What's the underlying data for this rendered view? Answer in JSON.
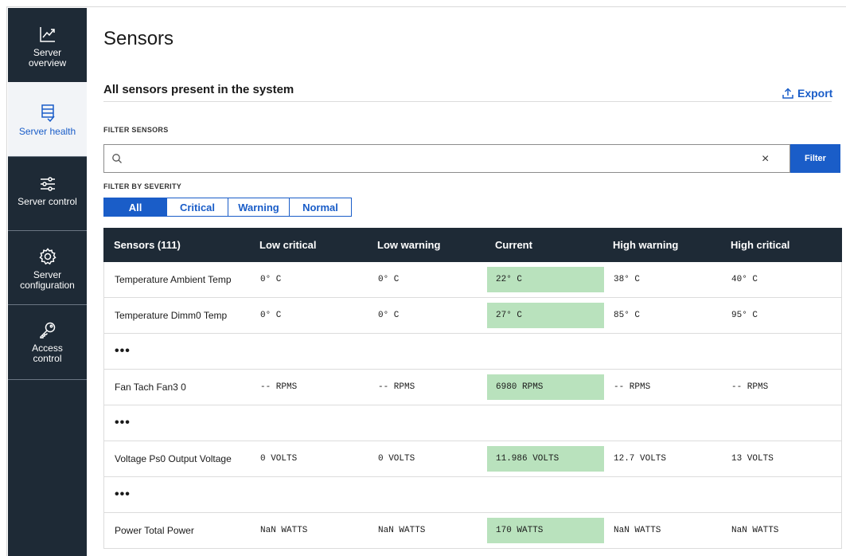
{
  "sidebar": {
    "items": [
      {
        "label": "Server\noverview",
        "icon": "chart-line-icon"
      },
      {
        "label": "Server health",
        "icon": "server-check-icon"
      },
      {
        "label": "Server control",
        "icon": "sliders-icon"
      },
      {
        "label": "Server\nconfiguration",
        "icon": "gear-icon"
      },
      {
        "label": "Access\ncontrol",
        "icon": "key-icon"
      }
    ]
  },
  "page": {
    "title": "Sensors",
    "section_title": "All sensors present in the system",
    "export_label": "Export"
  },
  "filter": {
    "label": "FILTER SENSORS",
    "search_value": "",
    "clear_symbol": "×",
    "button_label": "Filter"
  },
  "severity": {
    "label": "FILTER BY SEVERITY",
    "options": [
      "All",
      "Critical",
      "Warning",
      "Normal"
    ],
    "selected": "All"
  },
  "table": {
    "headers": [
      "Sensors (111)",
      "Low critical",
      "Low warning",
      "Current",
      "High warning",
      "High critical"
    ],
    "rows": [
      {
        "name": "Temperature Ambient Temp",
        "low_critical": "0° C",
        "low_warning": "0° C",
        "current": "22° C",
        "high_warning": "38° C",
        "high_critical": "40° C"
      },
      {
        "name": "Temperature Dimm0 Temp",
        "low_critical": "0° C",
        "low_warning": "0° C",
        "current": "27° C",
        "high_warning": "85° C",
        "high_critical": "95° C"
      },
      {
        "ellipsis": "•••"
      },
      {
        "name": "Fan Tach Fan3 0",
        "low_critical": "-- RPMS",
        "low_warning": "-- RPMS",
        "current": "6980 RPMS",
        "high_warning": "-- RPMS",
        "high_critical": "-- RPMS"
      },
      {
        "ellipsis": "•••"
      },
      {
        "name": "Voltage Ps0 Output Voltage",
        "low_critical": "0 VOLTS",
        "low_warning": "0 VOLTS",
        "current": "11.986 VOLTS",
        "high_warning": "12.7 VOLTS",
        "high_critical": "13 VOLTS"
      },
      {
        "ellipsis": "•••"
      },
      {
        "name": "Power Total Power",
        "low_critical": "NaN WATTS",
        "low_warning": "NaN WATTS",
        "current": "170 WATTS",
        "high_warning": "NaN WATTS",
        "high_critical": "NaN WATTS"
      }
    ]
  },
  "colors": {
    "sidebar_bg": "#1e2a36",
    "accent": "#1a5dc8",
    "current_highlight": "#b9e2bd"
  }
}
